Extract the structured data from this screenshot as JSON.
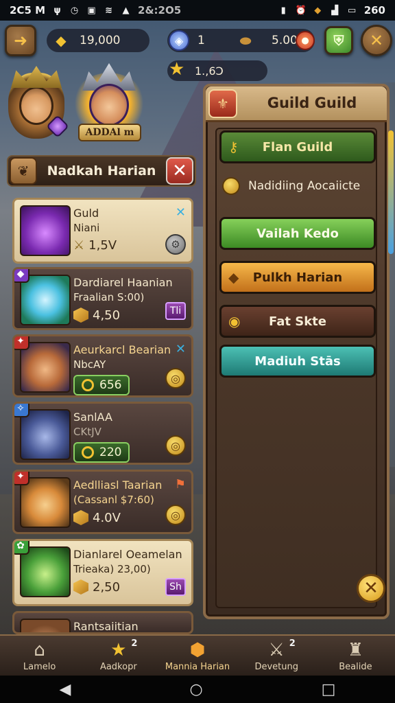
{
  "status_bar": {
    "time": "2C5 M",
    "left_icons": [
      "vibrate-icon",
      "clock-icon",
      "image-icon",
      "wifi-icon",
      "signal-icon"
    ],
    "center_text": "2&:2O5",
    "right_icons": [
      "battery-icon",
      "alarm-icon",
      "chest-icon",
      "signal-bars-icon",
      "battery-full-icon"
    ],
    "right_text": "260"
  },
  "hud": {
    "gold": "19,000",
    "gems": "1",
    "secondary": "5.00",
    "stars": "1.,6Ↄ"
  },
  "avatar_name": "ADDAl m",
  "left_panel": {
    "title": "Nadkah Harian",
    "cards": [
      {
        "name": "Guld",
        "sub": "Niani",
        "value": "1,5V",
        "style": "light",
        "badge": ""
      },
      {
        "name": "Dardiarel Haanian",
        "sub": "Fraalian S:00)",
        "value": "4,50",
        "tag": "Tli",
        "style": "dark"
      },
      {
        "name": "Aeurkarcl Bearian",
        "sub": "NbcAY",
        "value": "656",
        "style": "dark"
      },
      {
        "name": "SanlAA",
        "sub": "CKtJV",
        "value": "220",
        "style": "dark"
      },
      {
        "name": "Aedlliasl Taarian",
        "sub": "(Cassanl $7:60)",
        "value": "4.0V",
        "style": "dark"
      },
      {
        "name": "Dianlarel Oeamelan",
        "sub": "Trieaka) 23,00)",
        "value": "2,50",
        "tag": "Sh",
        "style": "light"
      },
      {
        "name": "Rantsaiitian",
        "style": "dark"
      }
    ]
  },
  "right_panel": {
    "title": "Guild Guild",
    "btn1": "Flan Guild",
    "info_line": "Nadidiing Aocaiicte",
    "btn2": "Vailah Kedo",
    "btn3": "Pulkh Harian",
    "btn4": "Fat Skte",
    "btn5": "Madiuh Stās"
  },
  "bottom_nav": [
    {
      "label": "Lamelo",
      "icon": "home-icon"
    },
    {
      "label": "Aadkopr",
      "icon": "star-icon",
      "count": "2"
    },
    {
      "label": "Mannia Harian",
      "icon": "guild-crest-icon"
    },
    {
      "label": "Devetung",
      "icon": "sword-icon",
      "count": "2"
    },
    {
      "label": "Bealide",
      "icon": "tower-icon"
    }
  ],
  "colors": {
    "accent_gold": "#f2c232",
    "panel_brown": "#4f3a2c",
    "button_green": "#3c8a24",
    "button_orange": "#c2701a",
    "button_teal": "#1e7a74"
  }
}
